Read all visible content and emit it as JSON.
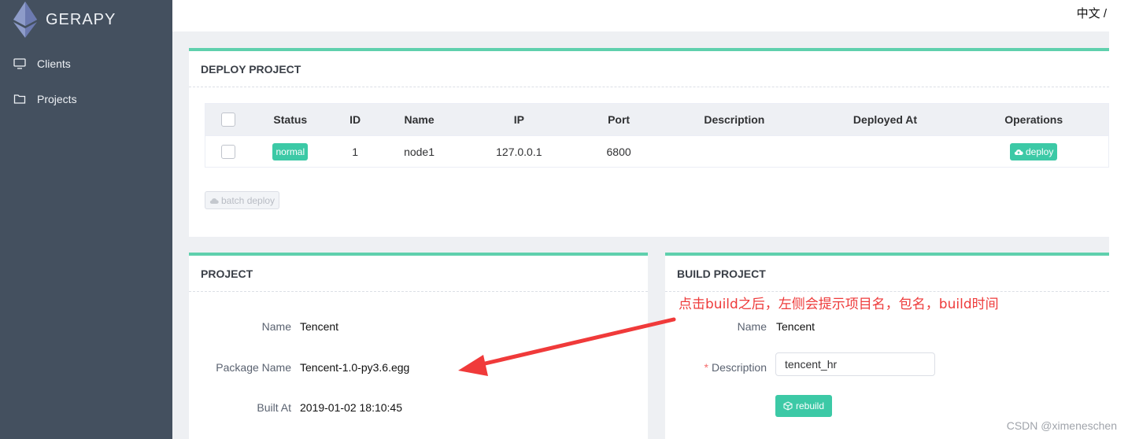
{
  "sidebar": {
    "brand": "GERAPY",
    "items": [
      {
        "label": "Clients",
        "icon": "monitor-icon"
      },
      {
        "label": "Projects",
        "icon": "folder-icon"
      }
    ]
  },
  "header": {
    "language": "中文 /"
  },
  "deploy_project": {
    "title": "DEPLOY PROJECT",
    "columns": [
      "Status",
      "ID",
      "Name",
      "IP",
      "Port",
      "Description",
      "Deployed At",
      "Operations"
    ],
    "rows": [
      {
        "status": "normal",
        "id": "1",
        "name": "node1",
        "ip": "127.0.0.1",
        "port": "6800",
        "description": "",
        "deployed_at": "",
        "operation": "deploy"
      }
    ],
    "batch_label": "batch deploy"
  },
  "project": {
    "title": "PROJECT",
    "name_label": "Name",
    "name_value": "Tencent",
    "package_label": "Package Name",
    "package_value": "Tencent-1.0-py3.6.egg",
    "built_label": "Built At",
    "built_value": "2019-01-02 18:10:45"
  },
  "build_project": {
    "title": "BUILD PROJECT",
    "name_label": "Name",
    "name_value": "Tencent",
    "description_label": "Description",
    "description_required": "*",
    "description_value": "tencent_hr",
    "rebuild_label": "rebuild"
  },
  "annotation": {
    "text": "点击build之后，左侧会提示项目名，包名，build时间",
    "color": "#ee3b3b"
  },
  "watermark": "CSDN @ximeneschen",
  "colors": {
    "sidebar_bg": "#44505f",
    "accent": "#3cc9a6",
    "card_border": "#5fd0ad"
  }
}
